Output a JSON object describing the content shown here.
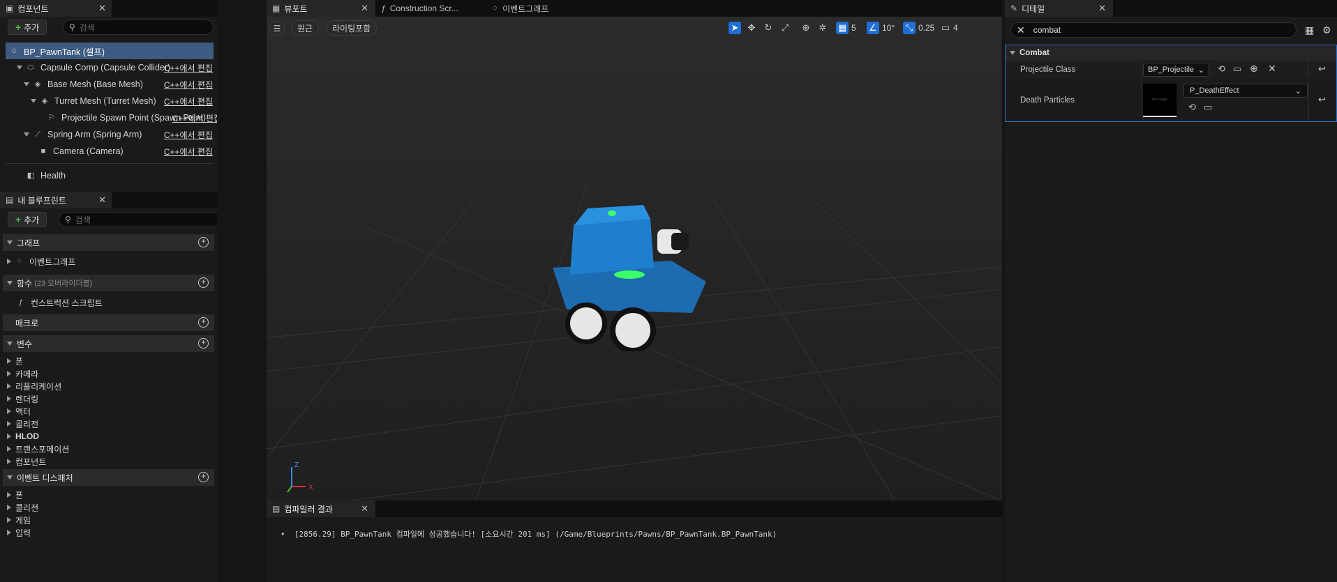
{
  "components_panel": {
    "tab_label": "컴포넌트",
    "add_label": "추가",
    "search_placeholder": "검색",
    "root": "BP_PawnTank (셀프)",
    "edit_label": "C++에서 편집",
    "items": [
      {
        "label": "Capsule Comp (Capsule Collider)",
        "edit": "C++에서 편집"
      },
      {
        "label": "Base Mesh (Base Mesh)",
        "edit": "C++에서 편집"
      },
      {
        "label": "Turret Mesh (Turret Mesh)",
        "edit": "C++에서 편집"
      },
      {
        "label": "Projectile Spawn Point (Spawn Point)",
        "edit": "C++에서 편집"
      },
      {
        "label": "Spring Arm (Spring Arm)",
        "edit": "C++에서 편집"
      },
      {
        "label": "Camera (Camera)",
        "edit": "C++에서 편집"
      }
    ],
    "health": "Health"
  },
  "blueprint_panel": {
    "tab_label": "내 블루프린트",
    "add_label": "추가",
    "search_placeholder": "검색",
    "graph_section": "그래프",
    "event_graph": "이벤트그래프",
    "functions_section": "함수",
    "functions_count": "(23 오버라이더블)",
    "construction_script": "컨스트럭션 스크립트",
    "macros_section": "매크로",
    "variables_section": "변수",
    "variable_categories": [
      "폰",
      "카메라",
      "리플리케이션",
      "렌더링",
      "액터",
      "콜리전",
      "HLOD",
      "트랜스포메이션",
      "컴포넌트"
    ],
    "dispatchers_section": "이벤트 디스패처",
    "dispatcher_categories": [
      "폰",
      "콜리전",
      "게임",
      "입력"
    ]
  },
  "editor_tabs": {
    "viewport": "뷰포트",
    "construction": "Construction Scr...",
    "event_graph": "이벤트그래프"
  },
  "viewport": {
    "perspective": "원근",
    "lighting": "라이팅포함",
    "grid_snap": "5",
    "rotation_snap": "10°",
    "scale_snap": "0.25",
    "camera_speed": "4",
    "axis_z": "Z",
    "axis_x": "X"
  },
  "compiler": {
    "tab_label": "컴파일러 결과",
    "message": "[2856.29] BP_PawnTank 컴파일에 성공했습니다! [소요시간 201 ms] (/Game/Blueprints/Pawns/BP_PawnTank.BP_PawnTank)"
  },
  "details": {
    "tab_label": "디테일",
    "search_value": "combat",
    "section": "Combat",
    "projectile_class_label": "Projectile Class",
    "projectile_class_value": "BP_Projectile",
    "death_particles_label": "Death Particles",
    "death_particles_value": "P_DeathEffect",
    "thumbnail_text": "No Image"
  }
}
